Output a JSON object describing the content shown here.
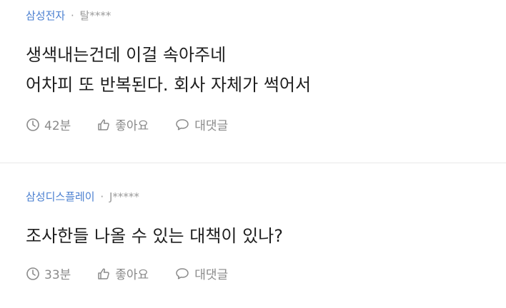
{
  "comments": [
    {
      "company": "삼성전자",
      "separator": "·",
      "author": "탈****",
      "lines": [
        "생색내는건데 이걸 속아주네",
        "어차피 또 반복된다. 회사 자체가 썩어서"
      ],
      "time": "42분",
      "like_label": "좋아요",
      "reply_label": "대댓글"
    },
    {
      "company": "삼성디스플레이",
      "separator": "·",
      "author": "J*****",
      "lines": [
        "조사한들 나올 수 있는 대책이 있나?"
      ],
      "time": "33분",
      "like_label": "좋아요",
      "reply_label": "대댓글"
    }
  ],
  "icons": {
    "time": "clock-icon",
    "like": "thumbs-up-icon",
    "reply": "speech-bubble-icon"
  },
  "colors": {
    "company": "#4a7fd0",
    "meta": "#9a9a9a",
    "body": "#1e1e1e",
    "action": "#8a8a8a",
    "divider": "#e8e8e8"
  }
}
